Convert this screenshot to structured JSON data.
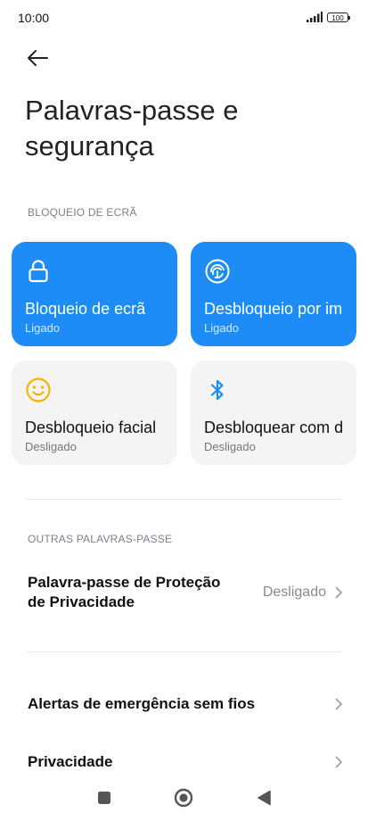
{
  "status_bar": {
    "time": "10:00",
    "battery": "100",
    "signal_icon": "signal-bars-icon"
  },
  "header": {
    "back_icon": "back-arrow-icon",
    "title": "Palavras-passe e segurança"
  },
  "screen_lock_section": {
    "label": "BLOQUEIO DE ECRÃ",
    "tiles": [
      {
        "icon": "padlock-icon",
        "title": "Bloqueio de ecrã",
        "status": "Ligado",
        "state": "on"
      },
      {
        "icon": "fingerprint-icon",
        "title": "Desbloqueio por impressão digital",
        "status": "Ligado",
        "state": "on"
      },
      {
        "icon": "smiley-face-icon",
        "title": "Desbloqueio facial",
        "status": "Desligado",
        "state": "off"
      },
      {
        "icon": "bluetooth-icon",
        "title": "Desbloquear com dispositivo Bluetooth",
        "status": "Desligado",
        "state": "off"
      }
    ]
  },
  "other_passwords_section": {
    "label": "OUTRAS PALAVRAS-PASSE",
    "privacy_password": {
      "title_line1": "Palavra-passe de Proteção",
      "title_line2": "de Privacidade",
      "value": "Desligado"
    }
  },
  "more": {
    "items": [
      {
        "title": "Alertas de emergência sem fios"
      },
      {
        "title": "Privacidade"
      }
    ]
  },
  "colors": {
    "accent": "#1e8cf7",
    "inactive_tile": "#f4f4f4",
    "face_icon": "#f5b400",
    "bluetooth_icon": "#1e8cf7"
  },
  "nav_bar": {
    "icons": [
      "recents-square-icon",
      "home-circle-icon",
      "back-triangle-icon"
    ]
  }
}
